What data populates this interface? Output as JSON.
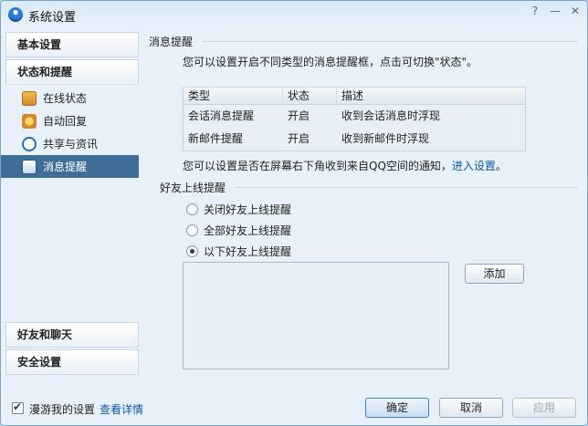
{
  "window": {
    "title": "系统设置",
    "controls": {
      "help": "?",
      "minimize": "—",
      "close": "✕"
    }
  },
  "sidebar": {
    "categories": {
      "basic": "基本设置",
      "status": "状态和提醒",
      "friends_chat": "好友和聊天",
      "security": "安全设置"
    },
    "items": [
      {
        "label": "在线状态",
        "icon": "online-status-icon"
      },
      {
        "label": "自动回复",
        "icon": "auto-reply-icon"
      },
      {
        "label": "共享与资讯",
        "icon": "share-news-icon"
      },
      {
        "label": "消息提醒",
        "icon": "message-reminder-icon",
        "selected": true
      }
    ]
  },
  "main": {
    "msg_section": {
      "heading": "消息提醒",
      "description": "您可以设置开启不同类型的消息提醒框，点击可切换\"状态\"。",
      "table": {
        "headers": [
          "类型",
          "状态",
          "描述"
        ],
        "rows": [
          [
            "会话消息提醒",
            "开启",
            "收到会话消息时浮现"
          ],
          [
            "新邮件提醒",
            "开启",
            "收到新邮件时浮现"
          ]
        ]
      },
      "qzone_note": "您可以设置是否在屏幕右下角收到来自QQ空间的通知，",
      "qzone_link": "进入设置",
      "qzone_after": "。"
    },
    "friend_section": {
      "heading": "好友上线提醒",
      "options": [
        {
          "label": "关闭好友上线提醒",
          "checked": false
        },
        {
          "label": "全部好友上线提醒",
          "checked": false
        },
        {
          "label": "以下好友上线提醒",
          "checked": true
        }
      ],
      "add_label": "添加"
    }
  },
  "footer": {
    "roam_label": "漫游我的设置",
    "roam_checked": true,
    "detail_link": "查看详情",
    "ok": "确定",
    "cancel": "取消",
    "apply": "应用"
  }
}
